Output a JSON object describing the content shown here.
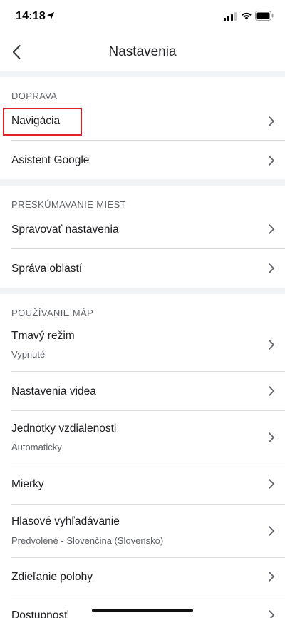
{
  "status_bar": {
    "time": "14:18",
    "icons": [
      "location-arrow-icon",
      "signal-icon",
      "wifi-icon",
      "battery-icon"
    ]
  },
  "header": {
    "title": "Nastavenia",
    "back_icon": "chevron-left-icon"
  },
  "sections": {
    "transport": {
      "header": "DOPRAVA",
      "items": [
        {
          "title": "Navigácia"
        },
        {
          "title": "Asistent Google"
        }
      ]
    },
    "explore": {
      "header": "PRESKÚMAVANIE MIEST",
      "items": [
        {
          "title": "Spravovať nastavenia"
        },
        {
          "title": "Správa oblastí"
        }
      ]
    },
    "maps": {
      "header": "POUŽÍVANIE MÁP",
      "items": [
        {
          "title": "Tmavý režim",
          "subtitle": "Vypnuté"
        },
        {
          "title": "Nastavenia videa"
        },
        {
          "title": "Jednotky vzdialenosti",
          "subtitle": "Automaticky"
        },
        {
          "title": "Mierky"
        },
        {
          "title": "Hlasové vyhľadávanie",
          "subtitle": "Predvolené - Slovenčina (Slovensko)"
        },
        {
          "title": "Zdieľanie polohy"
        },
        {
          "title": "Dostupnosť"
        }
      ]
    }
  },
  "colors": {
    "highlight": "#e0202a",
    "section_gap": "#f1f3f4",
    "divider": "#dadce0"
  }
}
